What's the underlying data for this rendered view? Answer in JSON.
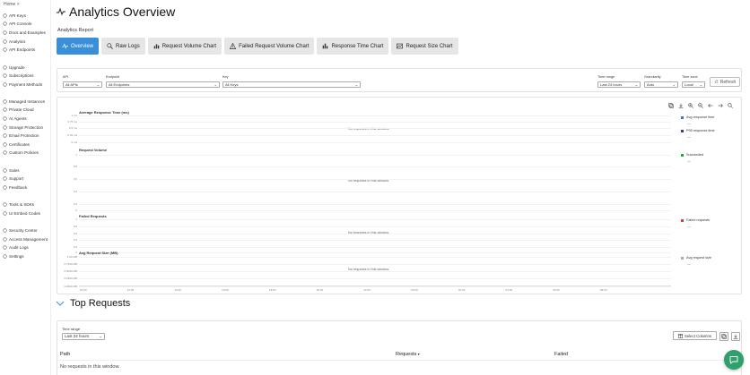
{
  "breadcrumb": "Home >",
  "sidebar": {
    "items": [
      {
        "label": "API Keys",
        "icon": "key-icon"
      },
      {
        "label": "API Console",
        "icon": "console-icon"
      },
      {
        "label": "Docs and Examples",
        "icon": "book-icon"
      },
      {
        "label": "Analytics",
        "icon": "analytics-icon"
      },
      {
        "label": "API Endpoints",
        "icon": "endpoint-icon"
      },
      {
        "label": "Upgrade",
        "icon": "upgrade-icon"
      },
      {
        "label": "Subscriptions",
        "icon": "subscription-icon"
      },
      {
        "label": "Payment Methods",
        "icon": "card-icon"
      },
      {
        "label": "Managed Instances",
        "icon": "server-icon"
      },
      {
        "label": "Private Cloud",
        "icon": "cloud-icon"
      },
      {
        "label": "AI Agents",
        "icon": "agent-icon"
      },
      {
        "label": "Storage Protection",
        "icon": "storage-icon"
      },
      {
        "label": "Email Protection",
        "icon": "mail-icon"
      },
      {
        "label": "Certificates",
        "icon": "certificate-icon"
      },
      {
        "label": "Custom Policies",
        "icon": "policy-icon"
      },
      {
        "label": "Sales",
        "icon": "sales-icon"
      },
      {
        "label": "Support",
        "icon": "support-icon"
      },
      {
        "label": "Feedback",
        "icon": "feedback-icon"
      },
      {
        "label": "Tools & SDKs",
        "icon": "tools-icon"
      },
      {
        "label": "UI Embed Codes",
        "icon": "embed-icon"
      },
      {
        "label": "Security Center",
        "icon": "shield-icon"
      },
      {
        "label": "Access Management",
        "icon": "users-icon"
      },
      {
        "label": "Audit Logs",
        "icon": "log-icon"
      },
      {
        "label": "Settings",
        "icon": "gear-icon"
      }
    ]
  },
  "page": {
    "title": "Analytics Overview",
    "report_label": "Analytics Report"
  },
  "tabs": [
    {
      "label": "Overview",
      "active": true
    },
    {
      "label": "Raw Logs"
    },
    {
      "label": "Request Volume Chart"
    },
    {
      "label": "Failed Request Volume Chart"
    },
    {
      "label": "Response Time Chart"
    },
    {
      "label": "Request Size Chart"
    }
  ],
  "filters": {
    "api_label": "API",
    "api_value": "All APIs",
    "endpoint_label": "Endpoint",
    "endpoint_value": "All Endpoints",
    "key_label": "Key",
    "key_value": "All Keys",
    "time_range_label": "Time range",
    "time_range_value": "Last 24 hours",
    "granularity_label": "Granularity",
    "granularity_value": "Auto",
    "timezone_label": "Time zone",
    "timezone_value": "Local",
    "refresh_label": "Refresh"
  },
  "charts": {
    "panels": [
      {
        "title": "Average Response Time (ms)",
        "empty": "No requests in this window.",
        "ticks": [
          "1 ms",
          "0.75 ms",
          "0.5 ms",
          "0.25 ms",
          "0 ms"
        ]
      },
      {
        "title": "Request Volume",
        "empty": "No requests in this window.",
        "ticks": [
          "1",
          "0.8",
          "0.6",
          "0.4",
          "0.2",
          "0"
        ]
      },
      {
        "title": "Failed Requests",
        "empty": "No requests in this window.",
        "ticks": [
          "1",
          "0.8",
          "0.6",
          "0.4",
          "0.2",
          "0"
        ]
      },
      {
        "title": "Avg Request Size (MB)",
        "empty": "No requests in this window.",
        "ticks": [
          "1.00 MB",
          "0.7500 MB",
          "0.5000 MB",
          "0.2500 MB",
          "0.0000 MB"
        ]
      }
    ],
    "legends": [
      {
        "label": "Avg response time",
        "value": "—",
        "color": "#4a6fd4"
      },
      {
        "label": "P95 response time",
        "value": "—",
        "color": "#3b3b8f"
      },
      {
        "label": "Succeeded",
        "value": "—",
        "color": "#2ea043"
      },
      {
        "label": "Failed requests",
        "value": "—",
        "color": "#e5383b"
      },
      {
        "label": "Avg request size",
        "value": "—",
        "color": "#aaaaaa"
      }
    ],
    "x_ticks": [
      "10:00",
      "12:00",
      "14:00",
      "16:00",
      "18:00",
      "20:00",
      "22:00",
      "00:00",
      "02:00",
      "04:00",
      "06:00",
      "08:00"
    ]
  },
  "top_requests": {
    "title": "Top Requests",
    "time_range_label": "Time range",
    "time_range_value": "Last 24 hours",
    "select_columns_label": "Select Columns",
    "columns": {
      "path": "Path",
      "requests": "Requests",
      "failed": "Failed"
    },
    "sort_indicator": "▾",
    "empty": "No requests in this window."
  },
  "colors": {
    "accent": "#3a8fd9",
    "chat": "#2ea06b"
  }
}
